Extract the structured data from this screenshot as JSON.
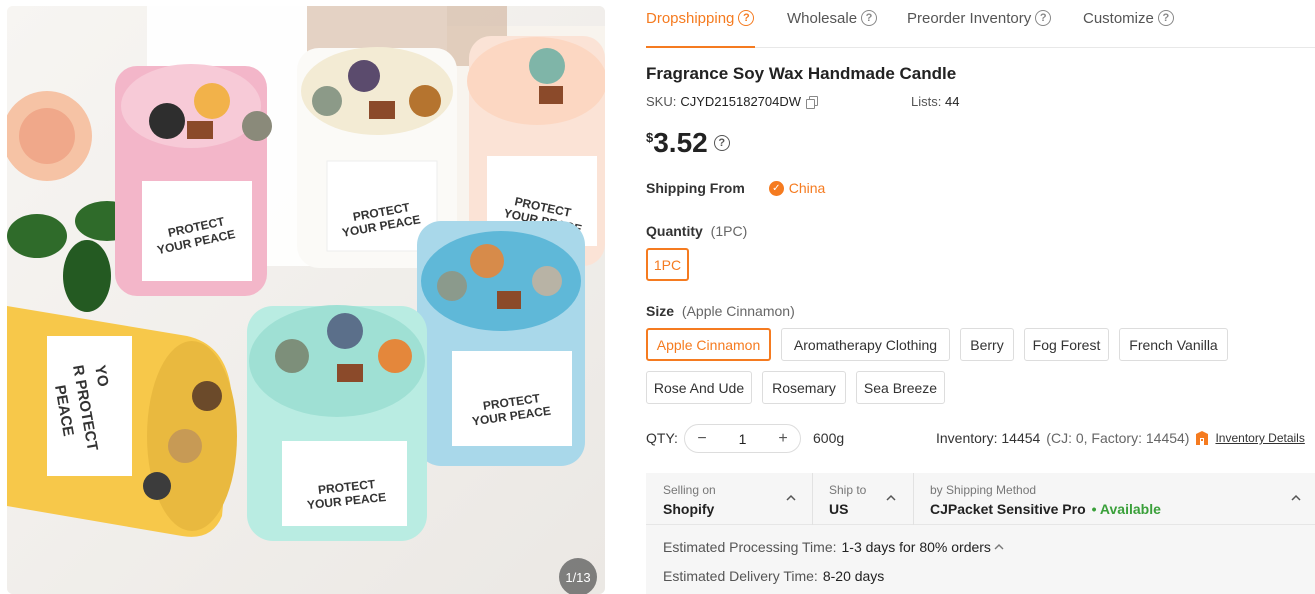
{
  "gallery": {
    "counter": "1/13",
    "labels": {
      "protect": "PROTECT",
      "your_peace": "YOUR PEACE",
      "yo": "YO",
      "r_protect": "R PROTECT",
      "peace": "PEACE"
    }
  },
  "tabs": [
    {
      "label": "Dropshipping",
      "active": true
    },
    {
      "label": "Wholesale",
      "active": false
    },
    {
      "label": "Preorder Inventory",
      "active": false
    },
    {
      "label": "Customize",
      "active": false
    }
  ],
  "product": {
    "title": "Fragrance Soy Wax Handmade Candle",
    "sku_label": "SKU:",
    "sku": "CJYD215182704DW",
    "lists_label": "Lists:",
    "lists": "44",
    "currency": "$",
    "price": "3.52"
  },
  "shipping_from": {
    "label": "Shipping From",
    "origin": "China"
  },
  "quantity": {
    "label": "Quantity",
    "hint": "(1PC)",
    "options": [
      "1PC"
    ],
    "selected": "1PC"
  },
  "size": {
    "label": "Size",
    "hint": "(Apple Cinnamon)",
    "options": [
      "Apple Cinnamon",
      "Aromatherapy Clothing",
      "Berry",
      "Fog Forest",
      "French Vanilla",
      "Rose And Ude",
      "Rosemary",
      "Sea Breeze"
    ],
    "selected": "Apple Cinnamon"
  },
  "qty_row": {
    "label": "QTY:",
    "value": "1",
    "minus": "−",
    "plus": "+",
    "weight": "600g",
    "inventory": "Inventory: 14454",
    "inventory_detail": "(CJ: 0, Factory: 14454)",
    "details_link": "Inventory Details"
  },
  "shipping": {
    "selling_on_label": "Selling on",
    "selling_on": "Shopify",
    "ship_to_label": "Ship to",
    "ship_to": "US",
    "method_label": "by Shipping Method",
    "method": "CJPacket Sensitive Pro",
    "availability": "• Available",
    "processing_label": "Estimated Processing Time:",
    "processing": "1-3 days for 80% orders",
    "delivery_label": "Estimated Delivery Time:",
    "delivery": "8-20 days"
  },
  "colors": {
    "accent": "#f57b20",
    "available": "#3aa03a"
  }
}
